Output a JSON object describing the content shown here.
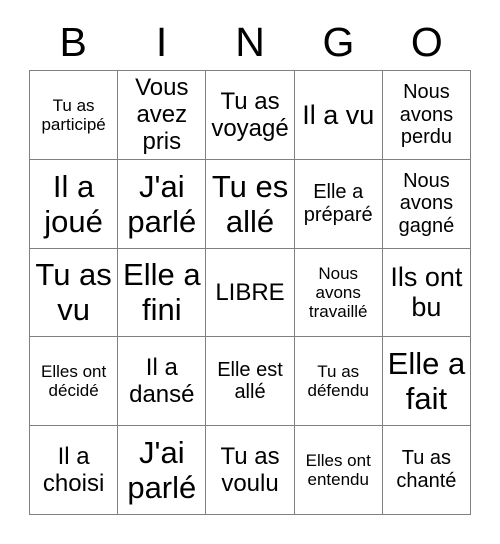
{
  "card": {
    "title": "BINGO",
    "columns": [
      "B",
      "I",
      "N",
      "G",
      "O"
    ],
    "free_space_label": "LIBRE",
    "grid_line_color": "#808080",
    "text_color": "#000000",
    "background_color": "#ffffff",
    "rows": 5,
    "cols": 5,
    "cells": [
      [
        {
          "text": "Tu as participé",
          "size": "xs"
        },
        {
          "text": "Vous avez pris",
          "size": "md"
        },
        {
          "text": "Tu as voyagé",
          "size": "md"
        },
        {
          "text": "Il a vu",
          "size": "lg"
        },
        {
          "text": "Nous avons perdu",
          "size": "sm"
        }
      ],
      [
        {
          "text": "Il a joué",
          "size": "xl"
        },
        {
          "text": "J'ai parlé",
          "size": "xl"
        },
        {
          "text": "Tu es allé",
          "size": "xl"
        },
        {
          "text": "Elle a préparé",
          "size": "sm"
        },
        {
          "text": "Nous avons gagné",
          "size": "sm"
        }
      ],
      [
        {
          "text": "Tu as vu",
          "size": "xl"
        },
        {
          "text": "Elle a fini",
          "size": "xl"
        },
        {
          "text": "LIBRE",
          "size": "free"
        },
        {
          "text": "Nous avons travaillé",
          "size": "xs"
        },
        {
          "text": "Ils ont bu",
          "size": "lg"
        }
      ],
      [
        {
          "text": "Elles ont décidé",
          "size": "xs"
        },
        {
          "text": "Il a dansé",
          "size": "md"
        },
        {
          "text": "Elle est allé",
          "size": "sm"
        },
        {
          "text": "Tu as défendu",
          "size": "xs"
        },
        {
          "text": "Elle a fait",
          "size": "xl"
        }
      ],
      [
        {
          "text": "Il a choisi",
          "size": "md"
        },
        {
          "text": "J'ai parlé",
          "size": "xl"
        },
        {
          "text": "Tu as voulu",
          "size": "md"
        },
        {
          "text": "Elles ont entendu",
          "size": "xs"
        },
        {
          "text": "Tu as chanté",
          "size": "sm"
        }
      ]
    ]
  }
}
